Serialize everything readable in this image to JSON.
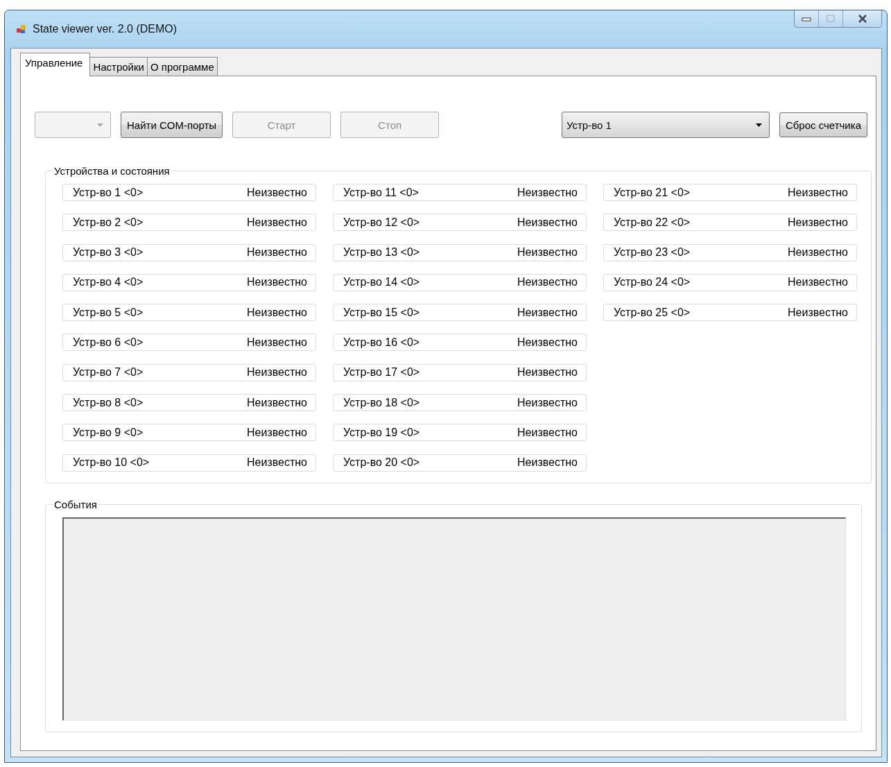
{
  "window": {
    "title": "State viewer ver. 2.0 (DEMO)"
  },
  "tabs": [
    {
      "label": "Управление",
      "selected": true
    },
    {
      "label": "Настройки",
      "selected": false
    },
    {
      "label": "О программе",
      "selected": false
    }
  ],
  "toolbar": {
    "port_select": {
      "disabled": true
    },
    "buttons": [
      {
        "label": "Найти COM-порты",
        "disabled": false
      },
      {
        "label": "Старт",
        "disabled": true
      },
      {
        "label": "Стоп",
        "disabled": true
      }
    ],
    "device_select": {
      "value": "Устр-во 1",
      "disabled": false
    },
    "reset_button": {
      "label": "Сброс счетчика",
      "disabled": false
    }
  },
  "devices_group": {
    "title": "Устройства и состояния",
    "devices": [
      {
        "name": "Устр-во 1 <0>",
        "state": "Неизвестно"
      },
      {
        "name": "Устр-во 2 <0>",
        "state": "Неизвестно"
      },
      {
        "name": "Устр-во 3 <0>",
        "state": "Неизвестно"
      },
      {
        "name": "Устр-во 4 <0>",
        "state": "Неизвестно"
      },
      {
        "name": "Устр-во 5 <0>",
        "state": "Неизвестно"
      },
      {
        "name": "Устр-во 6 <0>",
        "state": "Неизвестно"
      },
      {
        "name": "Устр-во 7 <0>",
        "state": "Неизвестно"
      },
      {
        "name": "Устр-во 8 <0>",
        "state": "Неизвестно"
      },
      {
        "name": "Устр-во 9 <0>",
        "state": "Неизвестно"
      },
      {
        "name": "Устр-во 10 <0>",
        "state": "Неизвестно"
      },
      {
        "name": "Устр-во 11 <0>",
        "state": "Неизвестно"
      },
      {
        "name": "Устр-во 12 <0>",
        "state": "Неизвестно"
      },
      {
        "name": "Устр-во 13 <0>",
        "state": "Неизвестно"
      },
      {
        "name": "Устр-во 14 <0>",
        "state": "Неизвестно"
      },
      {
        "name": "Устр-во 15 <0>",
        "state": "Неизвестно"
      },
      {
        "name": "Устр-во 16 <0>",
        "state": "Неизвестно"
      },
      {
        "name": "Устр-во 17 <0>",
        "state": "Неизвестно"
      },
      {
        "name": "Устр-во 18 <0>",
        "state": "Неизвестно"
      },
      {
        "name": "Устр-во 19 <0>",
        "state": "Неизвестно"
      },
      {
        "name": "Устр-во 20 <0>",
        "state": "Неизвестно"
      },
      {
        "name": "Устр-во 21 <0>",
        "state": "Неизвестно"
      },
      {
        "name": "Устр-во 22 <0>",
        "state": "Неизвестно"
      },
      {
        "name": "Устр-во 23 <0>",
        "state": "Неизвестно"
      },
      {
        "name": "Устр-во 24 <0>",
        "state": "Неизвестно"
      },
      {
        "name": "Устр-во 25 <0>",
        "state": "Неизвестно"
      }
    ]
  },
  "events_group": {
    "title": "События"
  }
}
